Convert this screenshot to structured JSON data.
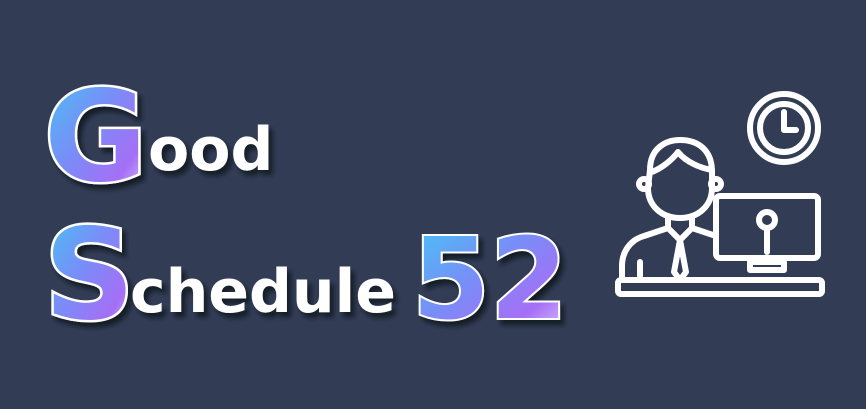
{
  "logo": {
    "line1": {
      "initial": "G",
      "rest": "ood"
    },
    "line2": {
      "initial": "S",
      "rest": "chedule",
      "number": "52"
    }
  },
  "colors": {
    "background": "#323c55",
    "text": "#ffffff",
    "gradient": [
      "#42c8f5",
      "#6f8df8",
      "#a46ff5",
      "#e4d2ff"
    ]
  },
  "illustration": {
    "icon": "person-at-computer-with-clock-icon"
  }
}
